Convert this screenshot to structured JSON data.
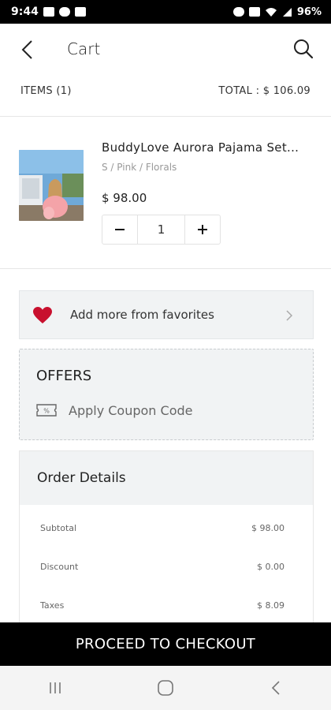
{
  "status_bar": {
    "time": "9:44",
    "battery": "96%"
  },
  "header": {
    "title": "Cart"
  },
  "summary": {
    "items_label": "ITEMS (1)",
    "total_label": "TOTAL : $ 106.09"
  },
  "cart_item": {
    "name": "BuddyLove Aurora Pajama Set...",
    "variant": "S / Pink / Florals",
    "price": "$ 98.00",
    "quantity": "1"
  },
  "favorites": {
    "label": "Add more from favorites"
  },
  "offers": {
    "title": "OFFERS",
    "coupon_label": "Apply Coupon Code"
  },
  "order_details": {
    "title": "Order Details",
    "rows": [
      {
        "label": "Subtotal",
        "value": "$ 98.00"
      },
      {
        "label": "Discount",
        "value": "$ 0.00"
      },
      {
        "label": "Taxes",
        "value": "$ 8.09"
      }
    ]
  },
  "checkout": {
    "label": "PROCEED TO CHECKOUT"
  },
  "colors": {
    "accent": "#000000",
    "heart": "#c8102e",
    "panel": "#f1f3f4"
  }
}
